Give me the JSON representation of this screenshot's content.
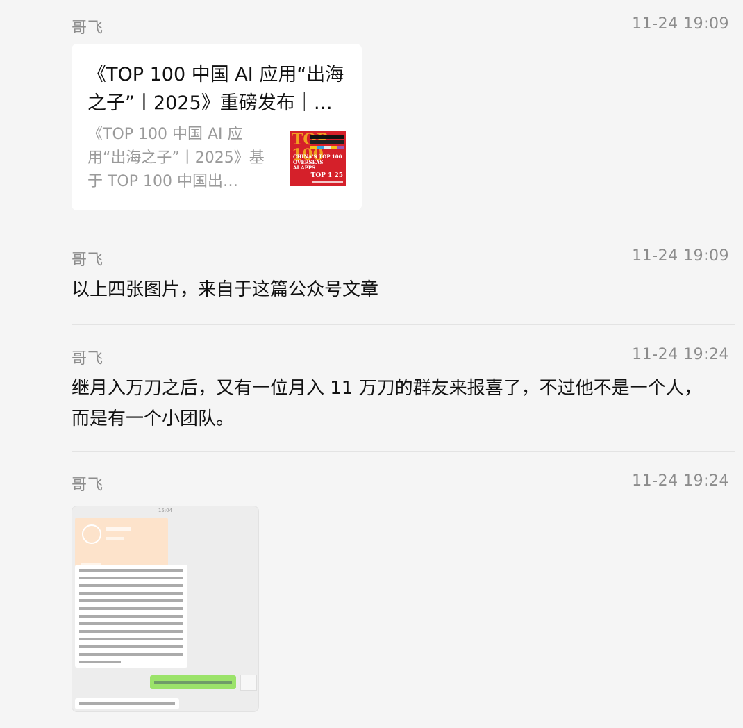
{
  "messages": [
    {
      "sender": "哥飞",
      "time": "11-24 19:09",
      "card": {
        "title": "《TOP 100 中国 AI 应用“出海之子”丨2025》重磅发布｜…",
        "desc": "《TOP 100 中国 AI 应用“出海之子”丨2025》基于 TOP 100 中国出…",
        "thumb_text": "TOP 100",
        "thumb_sub": "CHINA'S TOP 100\nOVERSEAS\nAI APPS",
        "thumb_corner": "TOP 1  25"
      }
    },
    {
      "sender": "哥飞",
      "time": "11-24 19:09",
      "text": "以上四张图片，来自于这篇公众号文章"
    },
    {
      "sender": "哥飞",
      "time": "11-24 19:24",
      "text": "继月入万刀之后，又有一位月入 11 万刀的群友来报喜了，不过他不是一个人，而是有一个小团队。"
    },
    {
      "sender": "哥飞",
      "time": "11-24 19:24",
      "image": {
        "top_time": "15:04"
      }
    }
  ],
  "colors": {
    "background": "#f5f5f5",
    "card": "#ffffff",
    "meta": "#8c8c8c",
    "thumb_red": "#d5202a"
  }
}
